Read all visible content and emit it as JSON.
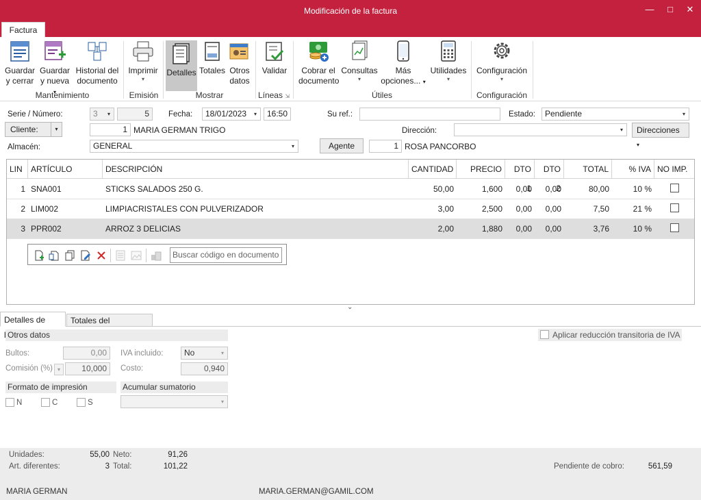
{
  "window": {
    "title": "Modificación de la factura",
    "minimize": "—",
    "maximize": "□",
    "close": "✕"
  },
  "ribbon": {
    "tab": "Factura",
    "buttons": {
      "guardar_cerrar": [
        "Guardar",
        "y cerrar"
      ],
      "guardar_nueva": [
        "Guardar",
        "y nueva"
      ],
      "historial": [
        "Historial del",
        "documento"
      ],
      "imprimir": "Imprimir",
      "detalles": "Detalles",
      "totales": "Totales",
      "otros_datos": [
        "Otros",
        "datos"
      ],
      "validar": "Validar",
      "cobrar": [
        "Cobrar el",
        "documento"
      ],
      "consultas": "Consultas",
      "mas_opciones": [
        "Más",
        "opciones..."
      ],
      "utilidades": "Utilidades",
      "configuracion": "Configuración"
    },
    "groups": {
      "mantenimiento": "Mantenimiento",
      "emision": "Emisión",
      "mostrar": "Mostrar",
      "lineas": "Líneas",
      "utiles": "Útiles",
      "configuracion": "Configuración"
    }
  },
  "header": {
    "serie_label": "Serie / Número:",
    "serie": "3",
    "numero": "5",
    "fecha_label": "Fecha:",
    "fecha": "18/01/2023",
    "hora": "16:50",
    "suref_label": "Su ref.:",
    "suref": "",
    "estado_label": "Estado:",
    "estado": "Pendiente",
    "cliente_btn": "Cliente:",
    "cliente_num": "1",
    "cliente_nombre": "MARIA GERMAN TRIGO",
    "direccion_label": "Dirección:",
    "direccion": "",
    "direcciones_btn": "Direcciones",
    "almacen_label": "Almacén:",
    "almacen": "GENERAL",
    "agente_btn": "Agente",
    "agente_num": "1",
    "agente_nombre": "ROSA PANCORBO"
  },
  "grid": {
    "columns": [
      "LIN",
      "ARTÍCULO",
      "DESCRIPCIÓN",
      "CANTIDAD",
      "PRECIO",
      "DTO 1",
      "DTO 2",
      "TOTAL",
      "% IVA",
      "NO IMP."
    ],
    "rows": [
      {
        "lin": "1",
        "articulo": "SNA001",
        "descripcion": "STICKS SALADOS 250 G.",
        "cantidad": "50,00",
        "precio": "1,600",
        "dto1": "0,00",
        "dto2": "0,00",
        "total": "80,00",
        "iva": "10 %",
        "noimp": false
      },
      {
        "lin": "2",
        "articulo": "LIM002",
        "descripcion": "LIMPIACRISTALES CON PULVERIZADOR",
        "cantidad": "3,00",
        "precio": "2,500",
        "dto1": "0,00",
        "dto2": "0,00",
        "total": "7,50",
        "iva": "21 %",
        "noimp": false
      },
      {
        "lin": "3",
        "articulo": "PPR002",
        "descripcion": "ARROZ 3 DELICIAS",
        "cantidad": "2,00",
        "precio": "1,880",
        "dto1": "0,00",
        "dto2": "0,00",
        "total": "3,76",
        "iva": "10 %",
        "noimp": false
      }
    ],
    "search_placeholder": "Buscar código en documento"
  },
  "bottom_tabs": {
    "detalles": "Detalles de línea",
    "totales": "Totales del documento"
  },
  "details": {
    "otros_datos": "Otros datos",
    "bultos_label": "Bultos:",
    "bultos": "0,00",
    "iva_incluido_label": "IVA incluido:",
    "iva_incluido": "No",
    "comision_label": "Comisión (%)",
    "comision": "10,000",
    "costo_label": "Costo:",
    "costo": "0,940",
    "formato_impresion": "Formato de impresión",
    "acumular_sumatorio": "Acumular sumatorio",
    "fmt_n": "N",
    "fmt_c": "C",
    "fmt_s": "S",
    "reduccion_iva": "Aplicar reducción transitoria de IVA"
  },
  "footer": {
    "unidades_label": "Unidades:",
    "unidades": "55,00",
    "art_dif_label": "Art. diferentes:",
    "art_dif": "3",
    "neto_label": "Neto:",
    "neto": "91,26",
    "total_label": "Total:",
    "total": "101,22",
    "pendiente_label": "Pendiente de cobro:",
    "pendiente": "561,59",
    "usuario": "MARIA GERMAN",
    "email": "MARIA.GERMAN@GAMIL.COM"
  }
}
